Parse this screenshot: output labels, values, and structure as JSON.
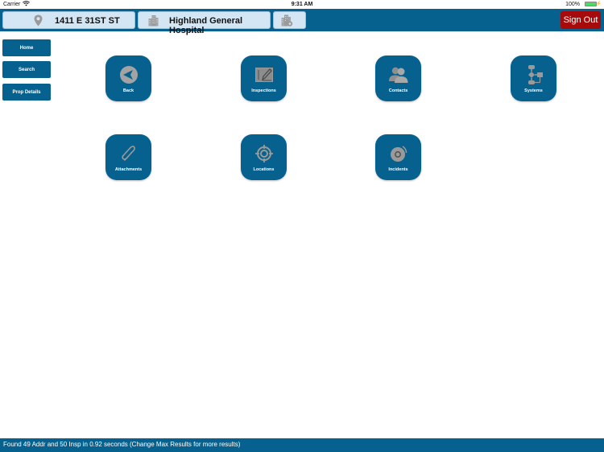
{
  "status_bar": {
    "carrier": "Carrier",
    "time": "9:31 AM",
    "battery_percent": "100%",
    "battery_level": 1.0
  },
  "header": {
    "address": "1411 E 31ST ST",
    "address_icon": "map-pin-icon",
    "property_name": "Highland General Hospital",
    "property_icon": "building-icon",
    "extra_icon": "building-settings-icon",
    "sign_out_label": "Sign Out"
  },
  "sidebar": {
    "items": [
      {
        "label": "Home"
      },
      {
        "label": "Search"
      },
      {
        "label": "Prop Details"
      }
    ]
  },
  "tiles": [
    {
      "label": "Back",
      "icon": "back-arrow-icon"
    },
    {
      "label": "Inspections",
      "icon": "inspection-edit-icon"
    },
    {
      "label": "Contacts",
      "icon": "contacts-icon"
    },
    {
      "label": "Systems",
      "icon": "systems-flow-icon"
    },
    {
      "label": "Attachments",
      "icon": "paperclip-icon"
    },
    {
      "label": "Locations",
      "icon": "crosshair-icon"
    },
    {
      "label": "Incidents",
      "icon": "alarm-bell-icon"
    }
  ],
  "footer": {
    "message": "Found 49 Addr and 50 Insp in 0.92 seconds (Change Max Results for more results)"
  },
  "colors": {
    "primary": "#06618f",
    "pill_background": "#d4e6f4",
    "sign_out": "#a60a0a",
    "icon_gray": "#9a9a9a"
  }
}
